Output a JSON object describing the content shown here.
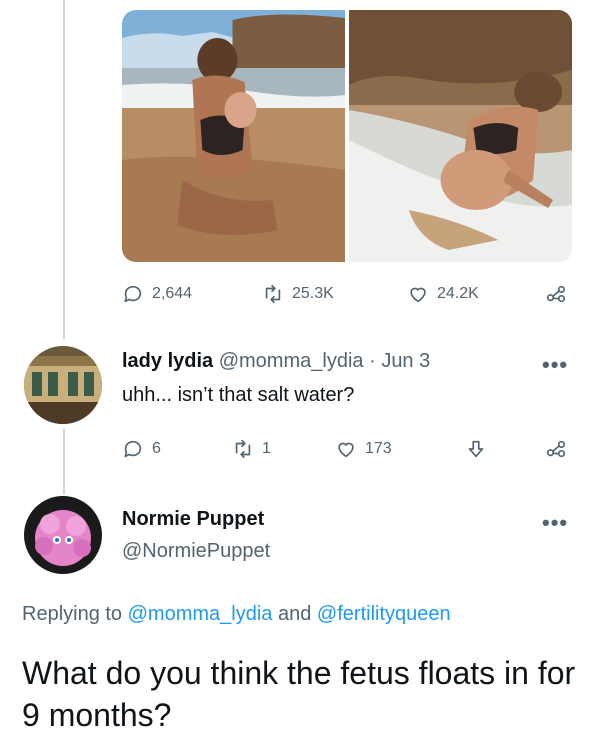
{
  "tweet": {
    "media": [
      {
        "icon": "photo-mother-holding-baby-at-beach"
      },
      {
        "icon": "photo-pregnant-woman-in-surf"
      }
    ],
    "actions": {
      "replies": "2,644",
      "retweets": "25.3K",
      "likes": "24.2K"
    }
  },
  "reply1": {
    "name": "lady lydia",
    "handle": "@momma_lydia",
    "separator": "·",
    "date": "Jun 3",
    "text": "uhh... isn’t that salt water?",
    "more": "•••",
    "actions": {
      "replies": "6",
      "retweets": "1",
      "likes": "173"
    }
  },
  "reply2": {
    "name": "Normie Puppet",
    "handle": "@NormiePuppet",
    "more": "•••",
    "replying_prefix": "Replying to",
    "replying_user1": "@momma_lydia",
    "replying_and": "and",
    "replying_user2": "@fertilityqueen",
    "text": "What do you think the fetus floats in for 9 months?"
  },
  "colors": {
    "accent": "#1d9bf0",
    "muted": "#536471",
    "line": "#cfd9de"
  }
}
